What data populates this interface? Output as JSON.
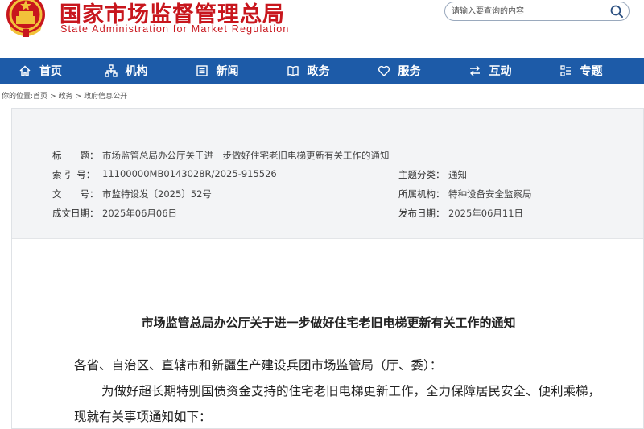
{
  "header": {
    "title_cn": "国家市场监督管理总局",
    "title_en": "State Administration for Market Regulation",
    "search_placeholder": "请输入要查询的内容"
  },
  "nav": {
    "items": [
      {
        "label": "首页",
        "icon": "home-icon"
      },
      {
        "label": "机构",
        "icon": "org-chart-icon"
      },
      {
        "label": "新闻",
        "icon": "news-icon"
      },
      {
        "label": "政务",
        "icon": "book-icon"
      },
      {
        "label": "服务",
        "icon": "heart-icon"
      },
      {
        "label": "互动",
        "icon": "exchange-arrows-icon"
      },
      {
        "label": "专题",
        "icon": "topics-icon"
      }
    ]
  },
  "breadcrumb": {
    "prefix": "你的位置:",
    "items": [
      "首页",
      "政务",
      "政府信息公开"
    ]
  },
  "meta": {
    "title_label": "标　　题：",
    "title_value": "市场监管总局办公厅关于进一步做好住宅老旧电梯更新有关工作的通知",
    "index_label": "索 引 号：",
    "index_value": "11100000MB0143028R/2025-915526",
    "topic_label": "主题分类：",
    "topic_value": "通知",
    "docno_label": "文　　号：",
    "docno_value": "市监特设发〔2025〕52号",
    "org_label": "所属机构：",
    "org_value": "特种设备安全监察局",
    "created_label": "成文日期：",
    "created_value": "2025年06月06日",
    "published_label": "发布日期：",
    "published_value": "2025年06月11日"
  },
  "document": {
    "title": "市场监管总局办公厅关于进一步做好住宅老旧电梯更新有关工作的通知",
    "salutation": "各省、自治区、直辖市和新疆生产建设兵团市场监管局（厅、委）：",
    "paragraph1": "为做好超长期特别国债资金支持的住宅老旧电梯更新工作，全力保障居民安全、便利乘梯，现就有关事项通知如下："
  },
  "colors": {
    "brand_red": "#c8161d",
    "nav_blue": "#1d5ba8",
    "meta_bg": "#f3f4f6"
  }
}
